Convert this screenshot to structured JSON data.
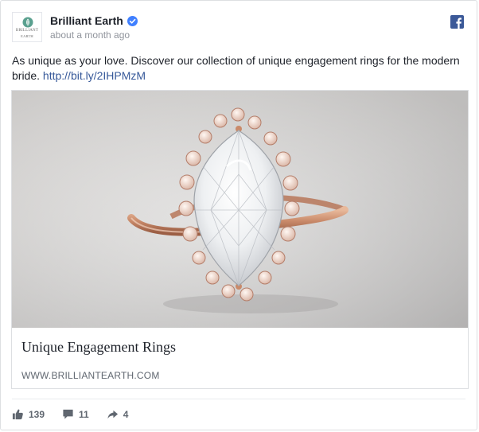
{
  "post": {
    "author": "Brilliant Earth",
    "timestamp": "about a month ago",
    "avatar_wordmark_line1": "BRILLIANT",
    "avatar_wordmark_line2": "EARTH",
    "message_text": "As unique as your love. Discover our collection of unique engagement rings for the modern bride. ",
    "message_link": "http://bit.ly/2IHPMzM",
    "verified_icon": "verified-badge-icon",
    "platform_icon": "facebook-icon"
  },
  "attachment": {
    "image_subject": "rose gold marquise diamond halo ring",
    "title": "Unique Engagement Rings",
    "domain": "WWW.BRILLIANTEARTH.COM"
  },
  "stats": {
    "likes": "139",
    "comments": "11",
    "shares": "4"
  },
  "colors": {
    "link": "#365899",
    "facebook_blue": "#3b5998",
    "verified_blue": "#4080ff",
    "muted_text": "#90949c"
  }
}
